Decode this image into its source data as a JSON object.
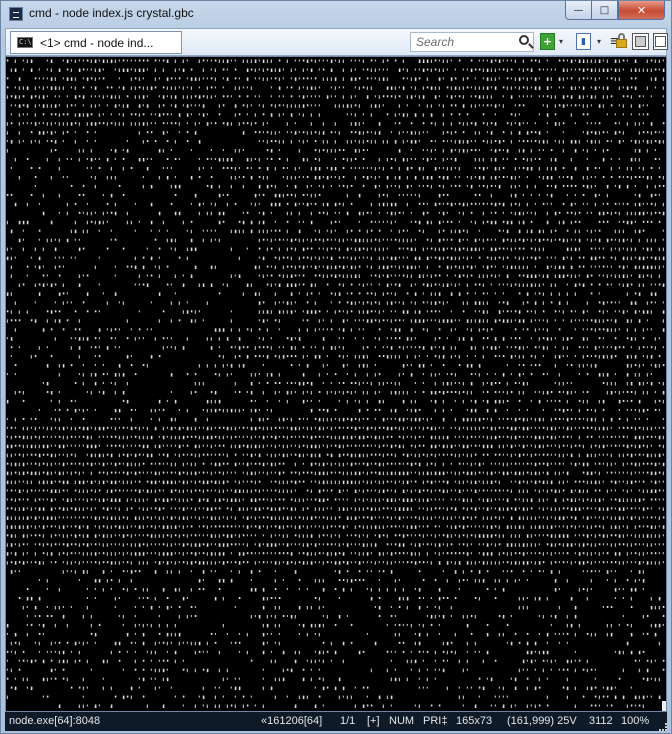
{
  "window": {
    "title": "cmd - node  index.js crystal.gbc",
    "minimize": "—",
    "maximize": "□",
    "close": "✕"
  },
  "toolbar": {
    "tab_label": "<1> cmd - node  ind...",
    "tab_icon_text": "C:\\",
    "search_placeholder": "Search",
    "add_label": "+",
    "dropdown_label": "▾",
    "menu_label": "≡"
  },
  "console": {
    "background": "#000000",
    "ascii_color": "#dcdcdc",
    "content": "ASCII-art rendering of a Game Boy Color game screen"
  },
  "status": {
    "process": "node.exe[64]:8048",
    "pos": "«161206[64]",
    "page": "1/1",
    "insert": "[+]",
    "num": "NUM",
    "pri": "PRI‡",
    "size": "165x73",
    "coords": "(161,999) 25V",
    "pid": "3112",
    "zoom": "100%"
  }
}
